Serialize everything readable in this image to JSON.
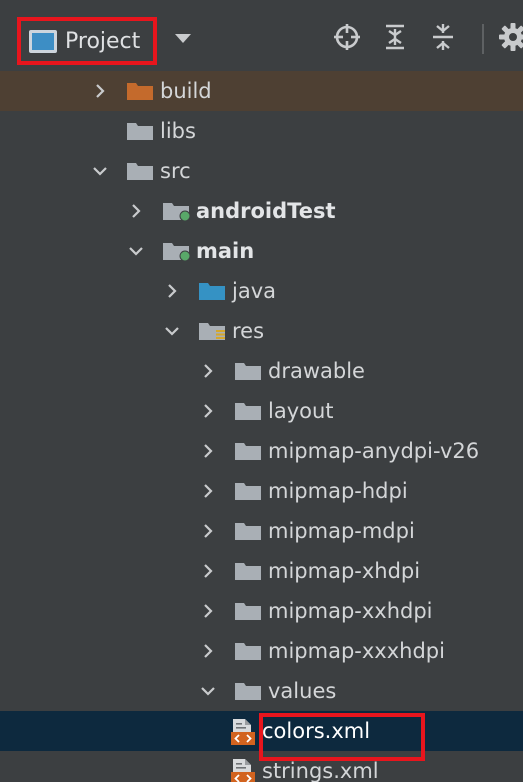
{
  "toolbar": {
    "project_label": "Project",
    "icons": [
      "target-icon",
      "expand-all-icon",
      "collapse-all-icon",
      "gear-icon"
    ]
  },
  "tree": {
    "items": [
      {
        "label": "build",
        "depth": 0,
        "chevron": "right",
        "icon": "folder-orange"
      },
      {
        "label": "libs",
        "depth": 0,
        "chevron": "none",
        "icon": "folder"
      },
      {
        "label": "src",
        "depth": 0,
        "chevron": "down",
        "icon": "folder"
      },
      {
        "label": "androidTest",
        "depth": 1,
        "chevron": "right",
        "icon": "source-folder",
        "bold": true
      },
      {
        "label": "main",
        "depth": 1,
        "chevron": "down",
        "icon": "source-folder",
        "bold": true
      },
      {
        "label": "java",
        "depth": 2,
        "chevron": "right",
        "icon": "folder-blue"
      },
      {
        "label": "res",
        "depth": 2,
        "chevron": "down",
        "icon": "resource-folder"
      },
      {
        "label": "drawable",
        "depth": 3,
        "chevron": "right",
        "icon": "folder"
      },
      {
        "label": "layout",
        "depth": 3,
        "chevron": "right",
        "icon": "folder"
      },
      {
        "label": "mipmap-anydpi-v26",
        "depth": 3,
        "chevron": "right",
        "icon": "folder"
      },
      {
        "label": "mipmap-hdpi",
        "depth": 3,
        "chevron": "right",
        "icon": "folder"
      },
      {
        "label": "mipmap-mdpi",
        "depth": 3,
        "chevron": "right",
        "icon": "folder"
      },
      {
        "label": "mipmap-xhdpi",
        "depth": 3,
        "chevron": "right",
        "icon": "folder"
      },
      {
        "label": "mipmap-xxhdpi",
        "depth": 3,
        "chevron": "right",
        "icon": "folder"
      },
      {
        "label": "mipmap-xxxhdpi",
        "depth": 3,
        "chevron": "right",
        "icon": "folder"
      },
      {
        "label": "values",
        "depth": 3,
        "chevron": "down",
        "icon": "folder"
      },
      {
        "label": "colors.xml",
        "depth": 4,
        "chevron": "none",
        "icon": "xml-file",
        "selected": true
      },
      {
        "label": "strings.xml",
        "depth": 4,
        "chevron": "none",
        "icon": "xml-file"
      }
    ]
  },
  "colors": {
    "panel_bg": "#3c3f41",
    "build_row_bg": "#4e4033",
    "selected_row_bg": "#0d293e",
    "highlight_border": "#e8151d",
    "folder_gray": "#a9afb5",
    "folder_orange": "#c46a2c",
    "folder_blue": "#3592c4",
    "source_dot": "#59a869"
  }
}
